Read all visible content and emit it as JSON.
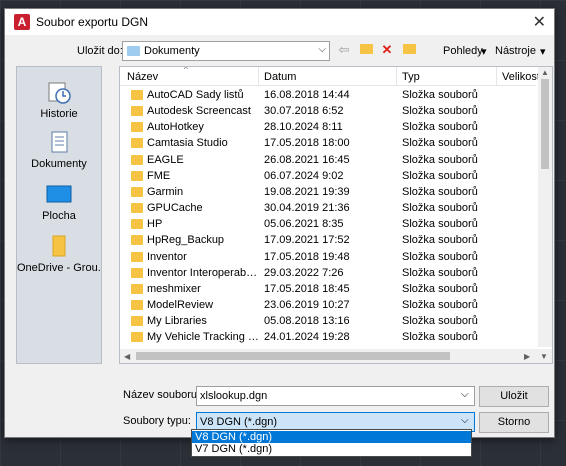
{
  "window": {
    "title": "Soubor exportu DGN"
  },
  "toolbar": {
    "save_in_label": "Uložit do:",
    "save_in_value": "Dokumenty",
    "views_label": "Pohledy",
    "tools_label": "Nástroje"
  },
  "places": [
    {
      "label": "Historie"
    },
    {
      "label": "Dokumenty"
    },
    {
      "label": "Plocha"
    },
    {
      "label": "OneDrive - Grou..."
    }
  ],
  "columns": {
    "name": "Název",
    "date": "Datum",
    "type": "Typ",
    "size": "Velikost"
  },
  "files": [
    {
      "name": "AutoCAD Sady listů",
      "date": "16.08.2018 14:44",
      "type": "Složka souborů"
    },
    {
      "name": "Autodesk Screencast",
      "date": "30.07.2018 6:52",
      "type": "Složka souborů"
    },
    {
      "name": "AutoHotkey",
      "date": "28.10.2024 8:11",
      "type": "Složka souborů"
    },
    {
      "name": "Camtasia Studio",
      "date": "17.05.2018 18:00",
      "type": "Složka souborů"
    },
    {
      "name": "EAGLE",
      "date": "26.08.2021 16:45",
      "type": "Složka souborů"
    },
    {
      "name": "FME",
      "date": "06.07.2024 9:02",
      "type": "Složka souborů"
    },
    {
      "name": "Garmin",
      "date": "19.08.2021 19:39",
      "type": "Složka souborů"
    },
    {
      "name": "GPUCache",
      "date": "30.04.2019 21:36",
      "type": "Složka souborů"
    },
    {
      "name": "HP",
      "date": "05.06.2021 8:35",
      "type": "Složka souborů"
    },
    {
      "name": "HpReg_Backup",
      "date": "17.09.2021 17:52",
      "type": "Složka souborů"
    },
    {
      "name": "Inventor",
      "date": "17.05.2018 19:48",
      "type": "Složka souborů"
    },
    {
      "name": "Inventor Interoperability",
      "date": "29.03.2022 7:26",
      "type": "Složka souborů"
    },
    {
      "name": "meshmixer",
      "date": "17.05.2018 18:45",
      "type": "Složka souborů"
    },
    {
      "name": "ModelReview",
      "date": "23.06.2019 10:27",
      "type": "Složka souborů"
    },
    {
      "name": "My Libraries",
      "date": "05.08.2018 13:16",
      "type": "Složka souborů"
    },
    {
      "name": "My Vehicle Tracking Da...",
      "date": "24.01.2024 19:28",
      "type": "Složka souborů"
    }
  ],
  "form": {
    "filename_label": "Název souboru:",
    "filename_value": "xlslookup.dgn",
    "filetype_label": "Soubory typu:",
    "filetype_value": "V8 DGN (*.dgn)",
    "filetype_options": [
      "V8 DGN (*.dgn)",
      "V7 DGN (*.dgn)"
    ],
    "save_button": "Uložit",
    "cancel_button": "Storno"
  }
}
